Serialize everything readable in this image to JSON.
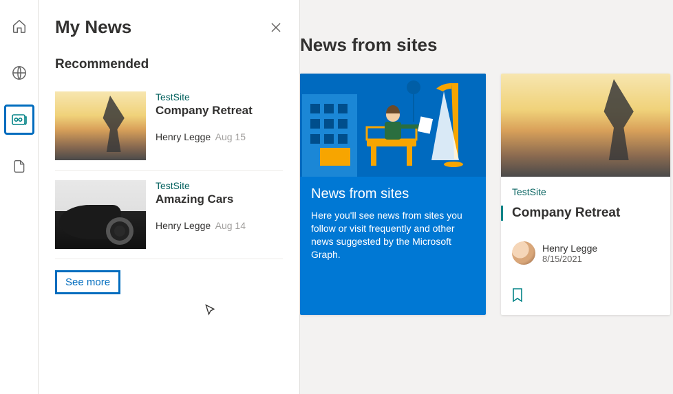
{
  "sidebar": {
    "items": [
      {
        "name": "home-icon"
      },
      {
        "name": "globe-icon"
      },
      {
        "name": "news-icon",
        "active": true
      },
      {
        "name": "file-icon"
      }
    ]
  },
  "panel": {
    "title": "My News",
    "section_title": "Recommended",
    "see_more": "See more",
    "items": [
      {
        "site": "TestSite",
        "title": "Company Retreat",
        "author": "Henry Legge",
        "date": "Aug 15",
        "thumb": "sunset"
      },
      {
        "site": "TestSite",
        "title": "Amazing Cars",
        "author": "Henry Legge",
        "date": "Aug 14",
        "thumb": "car"
      }
    ]
  },
  "main": {
    "heading": "News from sites",
    "promo_card": {
      "title": "News from sites",
      "body": "Here you'll see news from sites you follow or visit frequently and other news suggested by the Microsoft Graph."
    },
    "news_card": {
      "site": "TestSite",
      "title": "Company Retreat",
      "author": "Henry Legge",
      "date": "8/15/2021"
    }
  }
}
